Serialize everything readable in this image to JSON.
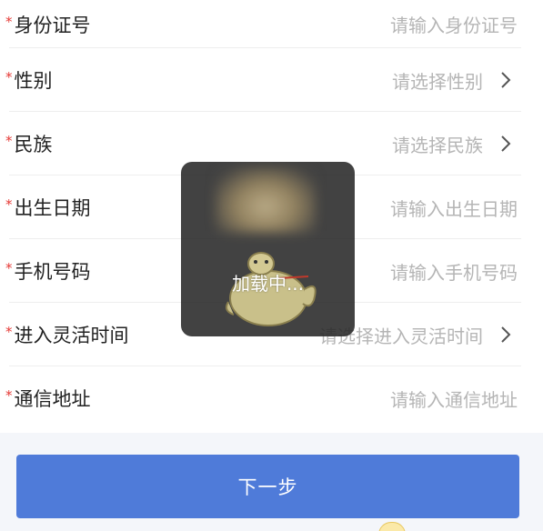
{
  "form": {
    "fields": [
      {
        "label": "身份证号",
        "required": "*",
        "type": "input",
        "placeholder": "请输入身份证号"
      },
      {
        "label": "性别",
        "required": "*",
        "type": "select",
        "placeholder": "请选择性别"
      },
      {
        "label": "民族",
        "required": "*",
        "type": "select",
        "placeholder": "请选择民族"
      },
      {
        "label": "出生日期",
        "required": "*",
        "type": "input",
        "placeholder": "请输入出生日期"
      },
      {
        "label": "手机号码",
        "required": "*",
        "type": "input",
        "placeholder": "请输入手机号码"
      },
      {
        "label": "进入灵活时间",
        "required": "*",
        "type": "select",
        "placeholder": "请选择进入灵活时间"
      },
      {
        "label": "通信地址",
        "required": "*",
        "type": "input",
        "placeholder": "请输入通信地址"
      }
    ]
  },
  "footer": {
    "next_label": "下一步"
  },
  "toast": {
    "text": "加载中..."
  },
  "icons": {
    "chevron": "chevron-right-icon",
    "mascot": "loading-mascot-icon"
  },
  "colors": {
    "primary": "#4f7bd9",
    "required": "#e53935",
    "placeholder": "#b5b5b5",
    "toast_bg": "#282828"
  }
}
